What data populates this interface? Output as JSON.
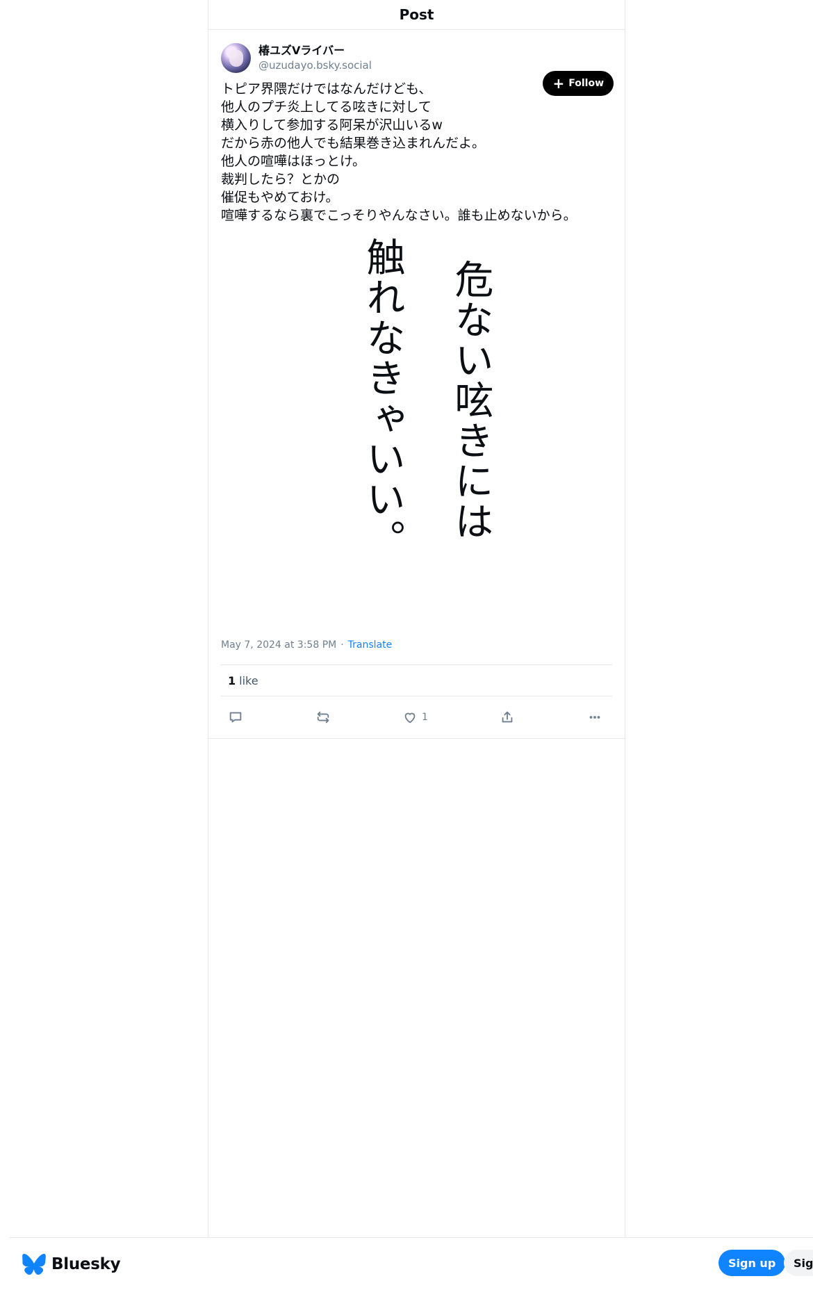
{
  "header": {
    "title": "Post"
  },
  "post": {
    "author": {
      "display_name": "椿ユズVライバー",
      "handle": "@uzudayo.bsky.social"
    },
    "follow_label": "Follow",
    "text": "トピア界隈だけではなんだけども、\n他人のプチ炎上してる呟きに対して\n横入りして参加する阿呆が沢山いるw\nだから赤の他人でも結果巻き込まれんだよ。\n他人の喧嘩はほっとけ。\n裁判したら？とかの\n催促もやめておけ。\n喧嘩するなら裏でこっそりやんなさい。誰も止めないから。",
    "image_text": {
      "right_column": "危ない呟きには",
      "left_column": "触れなきゃいい。"
    },
    "timestamp": "May 7, 2024 at 3:58 PM",
    "separator": "·",
    "translate_label": "Translate",
    "likes": {
      "count": "1",
      "label": "like"
    },
    "actions": {
      "like_count": "1"
    }
  },
  "bottom_bar": {
    "brand_name": "Bluesky",
    "signup_label": "Sign up",
    "signin_label": "Sign in"
  },
  "colors": {
    "accent": "#1083fe",
    "border": "#e3e8ec",
    "muted_text": "#6f7f8f"
  }
}
